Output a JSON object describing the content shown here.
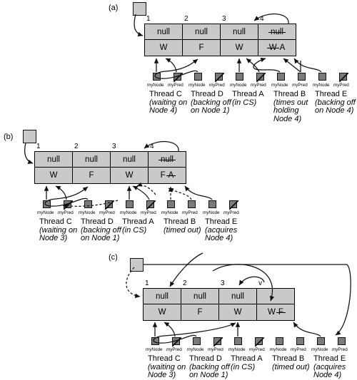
{
  "figure": {
    "panels": [
      {
        "id": "a",
        "label": "(a)",
        "node_indices": [
          "1",
          "2",
          "3",
          "4"
        ],
        "nodes": [
          {
            "index": "1",
            "top": "null",
            "top_struck": false,
            "bottom": "W",
            "bottom_struck": false,
            "bottom_extra": ""
          },
          {
            "index": "2",
            "top": "null",
            "top_struck": false,
            "bottom": "F",
            "bottom_struck": false,
            "bottom_extra": ""
          },
          {
            "index": "3",
            "top": "null",
            "top_struck": false,
            "bottom": "W",
            "bottom_struck": false,
            "bottom_extra": ""
          },
          {
            "index": "4",
            "top": "null",
            "top_struck": true,
            "bottom": "W",
            "bottom_struck": true,
            "bottom_extra": "A"
          }
        ],
        "threads": [
          {
            "name": "Thread C",
            "state": [
              "(waiting on",
              "Node 4)"
            ],
            "myNode": "myNode",
            "myPred": "myPred"
          },
          {
            "name": "Thread D",
            "state": [
              "(backing off",
              "on Node 1)"
            ],
            "myNode": "myNode",
            "myPred": "myPred"
          },
          {
            "name": "Thread A",
            "state": [
              "(in CS)"
            ],
            "myNode": "myNode",
            "myPred": "myPred"
          },
          {
            "name": "Thread B",
            "state": [
              "(times out",
              "holding",
              "Node 4)"
            ],
            "myNode": "myNode",
            "myPred": "myPred"
          },
          {
            "name": "Thread E",
            "state": [
              "(backing off",
              "on Node 4)"
            ],
            "myNode": "myNode",
            "myPred": "myPred"
          }
        ]
      },
      {
        "id": "b",
        "label": "(b)",
        "node_indices": [
          "1",
          "2",
          "3",
          "4"
        ],
        "nodes": [
          {
            "index": "1",
            "top": "null",
            "top_struck": false,
            "bottom": "W",
            "bottom_struck": false,
            "bottom_extra": ""
          },
          {
            "index": "2",
            "top": "null",
            "top_struck": false,
            "bottom": "F",
            "bottom_struck": false,
            "bottom_extra": ""
          },
          {
            "index": "3",
            "top": "null",
            "top_struck": false,
            "bottom": "W",
            "bottom_struck": false,
            "bottom_extra": ""
          },
          {
            "index": "4",
            "top": "null",
            "top_struck": true,
            "bottom": "F",
            "bottom_struck": false,
            "bottom_extra": "A"
          }
        ],
        "threads": [
          {
            "name": "Thread C",
            "state": [
              "(waiting on",
              "Node 3)"
            ],
            "myNode": "myNode",
            "myPred": "myPred"
          },
          {
            "name": "Thread D",
            "state": [
              "(backing off",
              "on Node 1)"
            ],
            "myNode": "myNode",
            "myPred": "myPred"
          },
          {
            "name": "Thread A",
            "state": [
              "(in CS)"
            ],
            "myNode": "myNode",
            "myPred": "myPred"
          },
          {
            "name": "Thread B",
            "state": [
              "(timed out)"
            ],
            "myNode": "myNode",
            "myPred": "myPred"
          },
          {
            "name": "Thread E",
            "state": [
              "(acquires",
              "Node 4)"
            ],
            "myNode": "myNode",
            "myPred": "myPred"
          }
        ]
      },
      {
        "id": "c",
        "label": "(c)",
        "node_indices": [
          "1",
          "2",
          "3",
          "v"
        ],
        "nodes": [
          {
            "index": "1",
            "top": "null",
            "top_struck": false,
            "bottom": "W",
            "bottom_struck": false,
            "bottom_extra": ""
          },
          {
            "index": "2",
            "top": "null",
            "top_struck": false,
            "bottom": "F",
            "bottom_struck": false,
            "bottom_extra": ""
          },
          {
            "index": "3",
            "top": "null",
            "top_struck": false,
            "bottom": "W",
            "bottom_struck": false,
            "bottom_extra": ""
          },
          {
            "index": "v",
            "top": "",
            "top_struck": false,
            "bottom": "W",
            "bottom_struck": false,
            "bottom_extra": "F"
          }
        ],
        "threads": [
          {
            "name": "Thread C",
            "state": [
              "(waiting on",
              "Node 3)"
            ],
            "myNode": "myNode",
            "myPred": "myPred"
          },
          {
            "name": "Thread D",
            "state": [
              "(backing off",
              "on Node 1)"
            ],
            "myNode": "myNode",
            "myPred": "myPred"
          },
          {
            "name": "Thread A",
            "state": [
              "(in CS)"
            ],
            "myNode": "myNode",
            "myPred": "myPred"
          },
          {
            "name": "Thread B",
            "state": [
              "(timed out)"
            ],
            "myNode": "myNode",
            "myPred": "myPred"
          },
          {
            "name": "Thread E",
            "state": [
              "(acquires",
              "Node 4)"
            ],
            "myNode": "myNode",
            "myPred": "myPred"
          }
        ]
      }
    ],
    "colors": {
      "node_fill": "#c9c9c9",
      "pointer_fill": "#7a7a7a",
      "stroke": "#111111",
      "background": "#ffffff"
    }
  }
}
